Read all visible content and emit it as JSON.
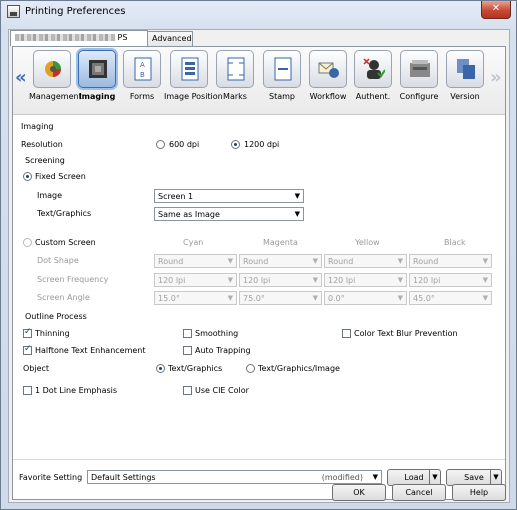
{
  "window": {
    "title": "Printing Preferences",
    "close_label": "✕"
  },
  "tabs": [
    {
      "label": "PS",
      "active": true
    },
    {
      "label": "Advanced",
      "active": false
    }
  ],
  "toolbar": {
    "left_arrow": "«",
    "right_arrow": "»",
    "items": [
      {
        "label": "Management",
        "icon": "management-icon"
      },
      {
        "label": "Imaging",
        "icon": "imaging-icon",
        "selected": true
      },
      {
        "label": "Forms",
        "icon": "forms-icon"
      },
      {
        "label": "Image Position",
        "icon": "image-position-icon"
      },
      {
        "label": "Marks",
        "icon": "marks-icon"
      },
      {
        "label": "Stamp",
        "icon": "stamp-icon"
      },
      {
        "label": "Workflow",
        "icon": "workflow-icon"
      },
      {
        "label": "Authent.",
        "icon": "authentication-icon"
      },
      {
        "label": "Configure",
        "icon": "configure-icon"
      },
      {
        "label": "Version",
        "icon": "version-icon"
      }
    ]
  },
  "imaging": {
    "section_title": "Imaging",
    "resolution_label": "Resolution",
    "res_600": "600 dpi",
    "res_1200": "1200 dpi",
    "selected_resolution": "1200 dpi"
  },
  "screening": {
    "section_title": "Screening",
    "fixed_label": "Fixed Screen",
    "image_label": "Image",
    "image_value": "Screen 1",
    "text_graphics_label": "Text/Graphics",
    "text_graphics_value": "Same as Image",
    "custom_label": "Custom Screen",
    "columns": [
      "Cyan",
      "Magenta",
      "Yellow",
      "Black"
    ],
    "dot_shape_label": "Dot Shape",
    "dot_shape": [
      "Round",
      "Round",
      "Round",
      "Round"
    ],
    "frequency_label": "Screen Frequency",
    "frequency": [
      "120 lpi",
      "120 lpi",
      "120 lpi",
      "120 lpi"
    ],
    "angle_label": "Screen Angle",
    "angle": [
      "15.0°",
      "75.0°",
      "0.0°",
      "45.0°"
    ]
  },
  "outline": {
    "section_title": "Outline Process",
    "thinning": "Thinning",
    "smoothing": "Smoothing",
    "color_blur": "Color Text Blur Prevention",
    "halftone": "Halftone Text Enhancement",
    "auto_trapping": "Auto Trapping",
    "object_label": "Object",
    "text_graphics": "Text/Graphics",
    "text_graphics_image": "Text/Graphics/Image",
    "dot_line": "1 Dot Line Emphasis",
    "cie_color": "Use CIE Color"
  },
  "favorite": {
    "label": "Favorite Setting",
    "value": "Default Settings",
    "status": "(modified)",
    "load": "Load",
    "save": "Save"
  },
  "dialog_buttons": {
    "ok": "OK",
    "cancel": "Cancel",
    "help": "Help"
  },
  "colors": {
    "accent": "#3b6fb0",
    "selected_tool": "#9cb9de",
    "close": "#c74a35"
  }
}
